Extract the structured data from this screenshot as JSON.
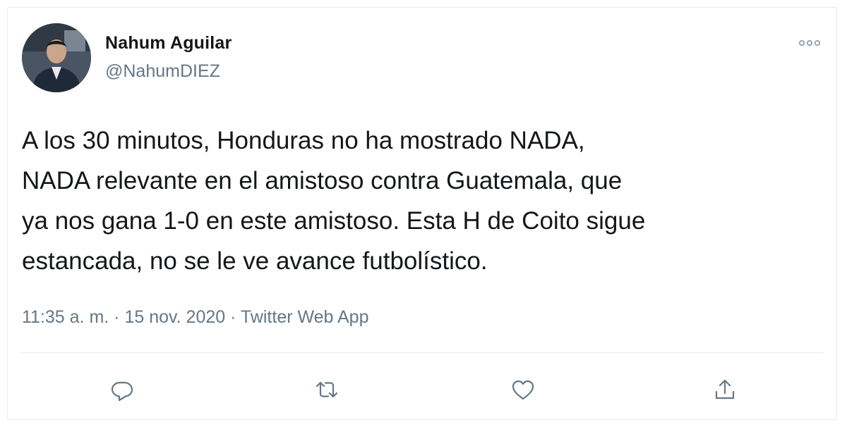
{
  "author": {
    "name": "Nahum Aguilar",
    "handle": "@NahumDIEZ",
    "avatar_icon": "profile-photo"
  },
  "tweet": {
    "text": "A los 30 minutos, Honduras no ha mostrado NADA,\nNADA relevante en el amistoso contra Guatemala, que\nya nos gana 1-0 en este amistoso. Esta H de Coito sigue\nestancada, no se le ve avance futbolístico.",
    "time": "11:35 a. m.",
    "date": "15 nov. 2020",
    "source": "Twitter Web App",
    "separator": " · "
  },
  "actions": {
    "reply_icon": "reply-icon",
    "retweet_icon": "retweet-icon",
    "like_icon": "like-icon",
    "share_icon": "share-icon"
  },
  "colors": {
    "text": "#14171a",
    "secondary": "#657786",
    "border": "#e6ecf0"
  }
}
